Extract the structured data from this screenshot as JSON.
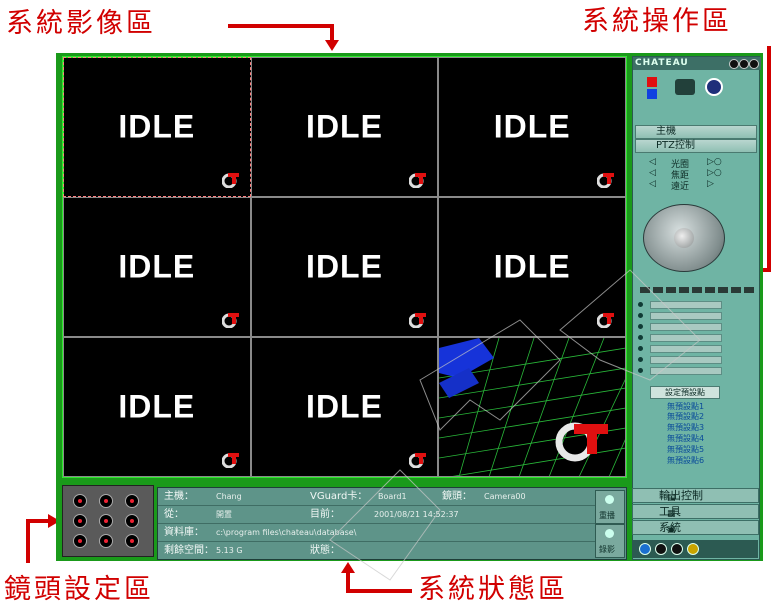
{
  "annotations": {
    "video_area": "系統影像區",
    "operation_area": "系統操作區",
    "lens_area": "鏡頭設定區",
    "status_area": "系統狀態區"
  },
  "video": {
    "cells": [
      "IDLE",
      "IDLE",
      "IDLE",
      "IDLE",
      "IDLE",
      "IDLE",
      "IDLE",
      "IDLE"
    ]
  },
  "panel": {
    "title": "CHATEAU",
    "menu_host": "主機",
    "menu_ptz": "PTZ控制",
    "iris": "光圈",
    "focus": "焦距",
    "zoom": "遠近",
    "preset_header": "設定預設點",
    "presets": [
      "無預設點1",
      "無預設點2",
      "無預設點3",
      "無預設點4",
      "無預設點5",
      "無預設點6"
    ],
    "menu_output": "輸出控制",
    "menu_tools": "工具",
    "menu_system": "系統"
  },
  "status": {
    "host_label": "主機：",
    "host_value": "Chang",
    "card_label": "VGuard卡：",
    "card_value": "Board1",
    "lens_label": "鏡頭：",
    "lens_value": "Camera00",
    "from_label": "從：",
    "from_value": "開置",
    "now_label": "目前：",
    "now_value": "2001/08/21 14:52:37",
    "db_label": "資料庫：",
    "db_value": "c:\\program files\\chateau\\database\\",
    "space_label": "剩餘空間：",
    "space_value": "5.13 G",
    "state_label": "狀態：",
    "btn_playback": "重播",
    "btn_record": "錄影"
  },
  "colors": {
    "accent_red": "#d10000",
    "frame_green": "#1a9a1a",
    "panel_teal": "#6fb4a4"
  }
}
